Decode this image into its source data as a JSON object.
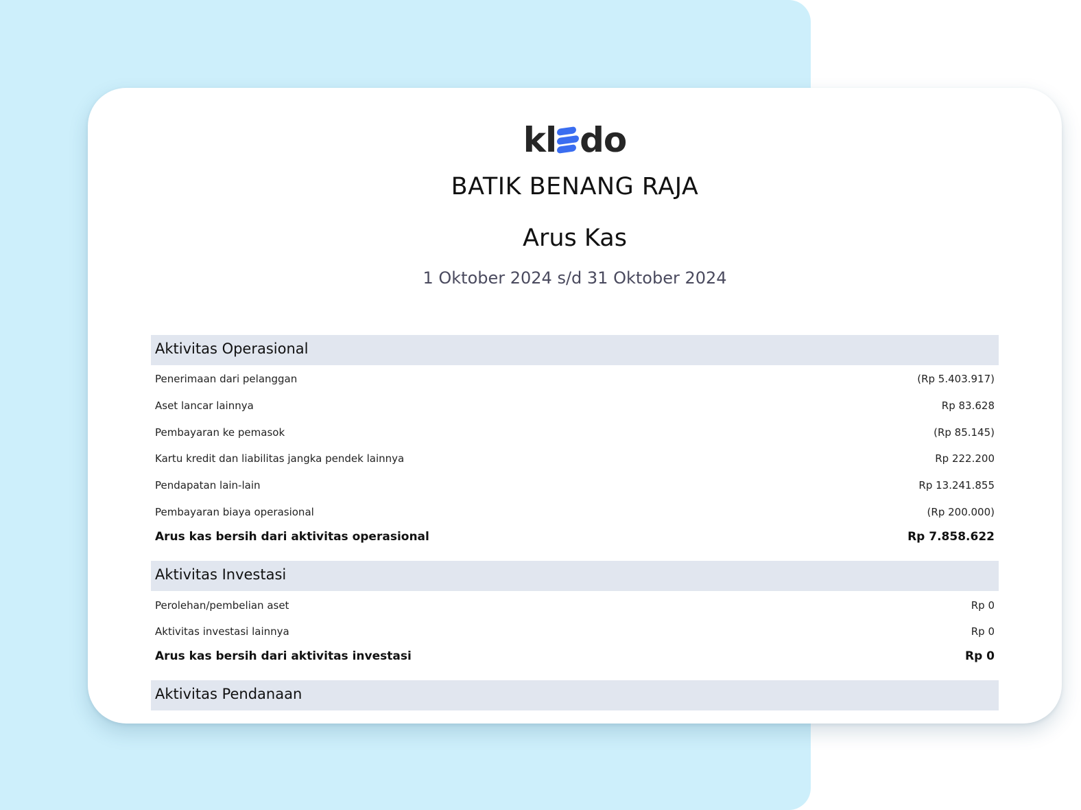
{
  "logo": {
    "text_before": "kl",
    "text_after": "do",
    "brand_color": "#3a6df0"
  },
  "company_name": "BATIK BENANG RAJA",
  "report_title": "Arus Kas",
  "period": "1 Oktober 2024 s/d 31 Oktober 2024",
  "sections": [
    {
      "title": "Aktivitas Operasional",
      "rows": [
        {
          "name": "Penerimaan dari pelanggan",
          "amount": "(Rp 5.403.917)"
        },
        {
          "name": "Aset lancar lainnya",
          "amount": "Rp 83.628"
        },
        {
          "name": "Pembayaran ke pemasok",
          "amount": "(Rp 85.145)"
        },
        {
          "name": "Kartu kredit dan liabilitas jangka pendek lainnya",
          "amount": "Rp 222.200"
        },
        {
          "name": "Pendapatan lain-lain",
          "amount": "Rp 13.241.855"
        },
        {
          "name": "Pembayaran biaya operasional",
          "amount": "(Rp 200.000)"
        }
      ],
      "total": {
        "name": "Arus kas bersih dari aktivitas operasional",
        "amount": "Rp 7.858.622"
      }
    },
    {
      "title": "Aktivitas Investasi",
      "rows": [
        {
          "name": "Perolehan/pembelian aset",
          "amount": "Rp 0"
        },
        {
          "name": "Aktivitas investasi lainnya",
          "amount": "Rp 0"
        }
      ],
      "total": {
        "name": "Arus kas bersih dari aktivitas investasi",
        "amount": "Rp 0"
      }
    },
    {
      "title": "Aktivitas Pendanaan"
    }
  ]
}
